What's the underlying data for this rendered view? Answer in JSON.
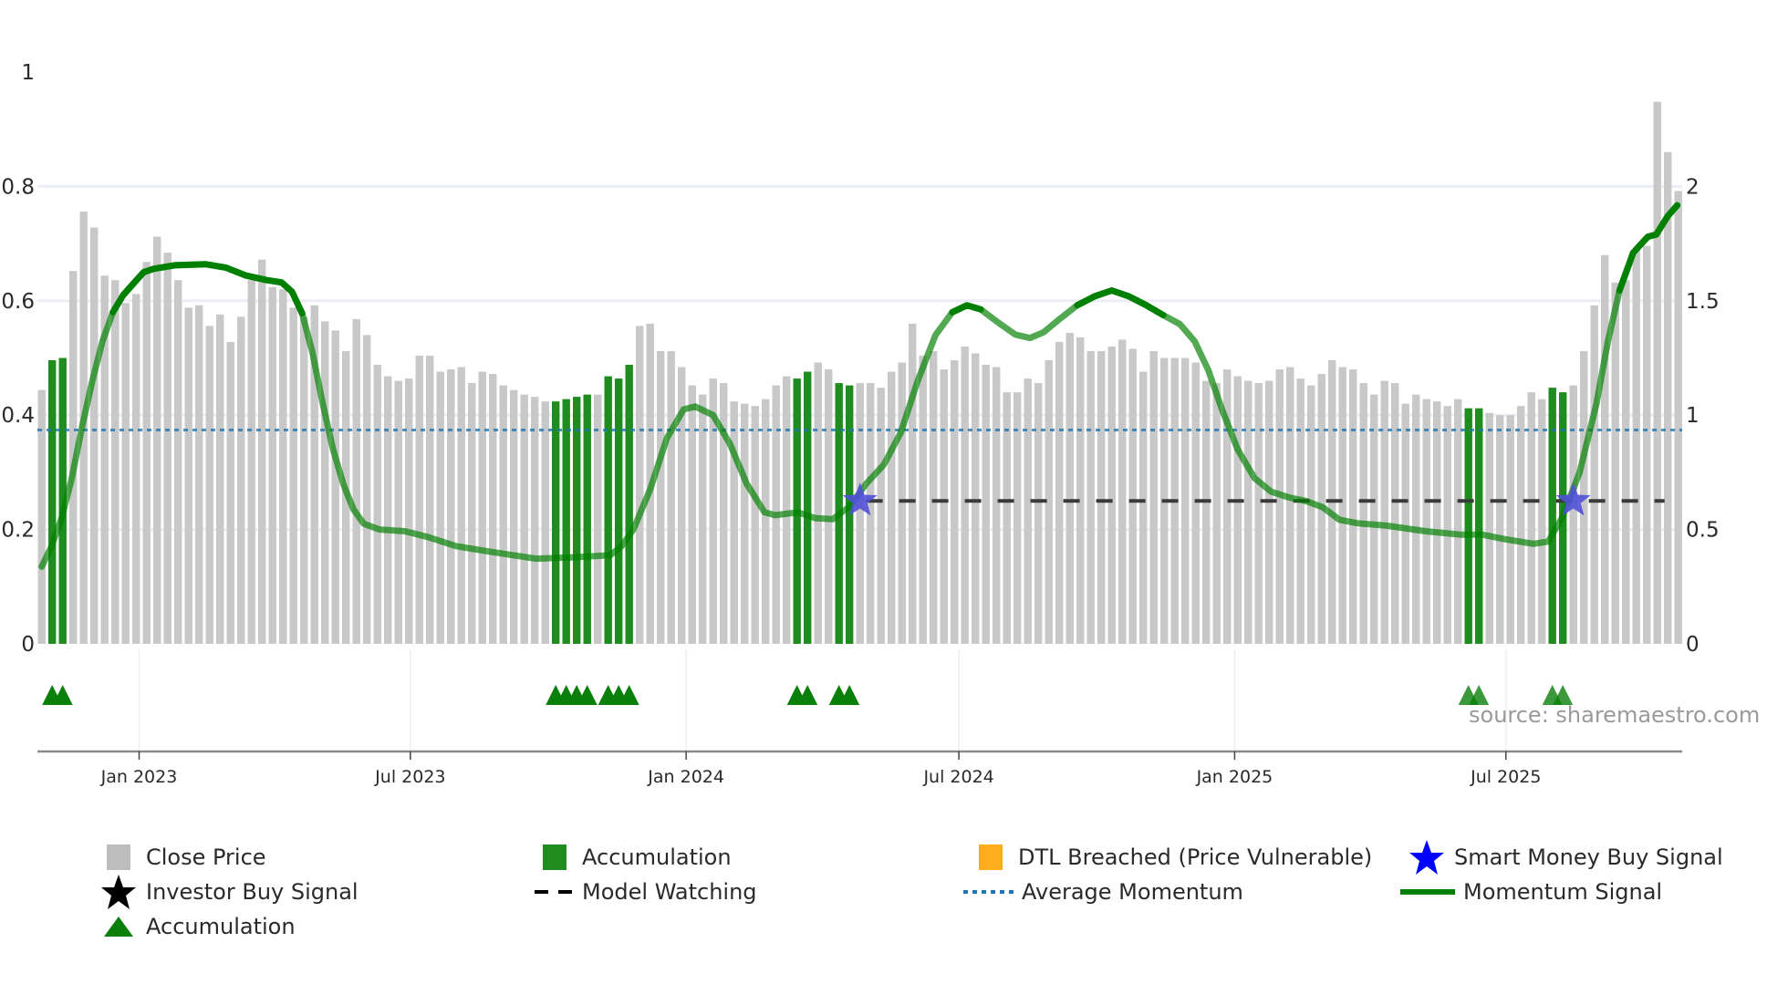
{
  "chart_data": {
    "type": "bar",
    "title": "",
    "start_date": "2022-10-28",
    "interval": "weekly",
    "left_axis": {
      "ylim": [
        0,
        1
      ],
      "ticks": [
        "0",
        "0.2",
        "0.4",
        "0.6",
        "0.8",
        "1"
      ]
    },
    "right_axis": {
      "ylim": [
        0,
        2.5
      ],
      "ticks": [
        "0",
        "0.5",
        "1",
        "1.5",
        "2"
      ]
    },
    "x_ticks": [
      {
        "date": "2023-01-01",
        "label": "Jan 2023"
      },
      {
        "date": "2023-07-01",
        "label": "Jul 2023"
      },
      {
        "date": "2024-01-01",
        "label": "Jan 2024"
      },
      {
        "date": "2024-07-01",
        "label": "Jul 2024"
      },
      {
        "date": "2025-01-01",
        "label": "Jan 2025"
      },
      {
        "date": "2025-07-01",
        "label": "Jul 2025"
      }
    ],
    "close_price": [
      1.11,
      1.24,
      1.25,
      1.63,
      1.89,
      1.82,
      1.61,
      1.59,
      1.49,
      1.53,
      1.67,
      1.78,
      1.71,
      1.59,
      1.47,
      1.48,
      1.39,
      1.44,
      1.32,
      1.43,
      1.59,
      1.68,
      1.56,
      1.55,
      1.47,
      1.43,
      1.48,
      1.41,
      1.37,
      1.28,
      1.42,
      1.35,
      1.22,
      1.17,
      1.15,
      1.16,
      1.26,
      1.26,
      1.19,
      1.2,
      1.21,
      1.14,
      1.19,
      1.18,
      1.13,
      1.11,
      1.09,
      1.08,
      1.06,
      1.06,
      1.07,
      1.08,
      1.09,
      1.09,
      1.17,
      1.16,
      1.22,
      1.39,
      1.4,
      1.28,
      1.28,
      1.21,
      1.13,
      1.09,
      1.16,
      1.14,
      1.06,
      1.05,
      1.04,
      1.07,
      1.13,
      1.17,
      1.16,
      1.19,
      1.23,
      1.2,
      1.14,
      1.13,
      1.14,
      1.14,
      1.12,
      1.19,
      1.23,
      1.4,
      1.26,
      1.28,
      1.2,
      1.24,
      1.3,
      1.27,
      1.22,
      1.21,
      1.1,
      1.1,
      1.16,
      1.14,
      1.24,
      1.32,
      1.36,
      1.34,
      1.28,
      1.28,
      1.3,
      1.33,
      1.29,
      1.19,
      1.28,
      1.25,
      1.25,
      1.25,
      1.23,
      1.15,
      1.14,
      1.2,
      1.17,
      1.15,
      1.14,
      1.15,
      1.2,
      1.21,
      1.16,
      1.13,
      1.18,
      1.24,
      1.21,
      1.2,
      1.14,
      1.09,
      1.15,
      1.14,
      1.05,
      1.09,
      1.07,
      1.06,
      1.04,
      1.07,
      1.03,
      1.03,
      1.01,
      1.0,
      1.0,
      1.04,
      1.1,
      1.07,
      1.12,
      1.1,
      1.13,
      1.28,
      1.48,
      1.7,
      1.58,
      1.59,
      1.72,
      1.74,
      2.37,
      2.15,
      1.98
    ],
    "accumulation_weeks": [
      1,
      2,
      49,
      50,
      51,
      52,
      54,
      55,
      56,
      72,
      73,
      76,
      77,
      136,
      137,
      144,
      145
    ],
    "momentum_signal": [
      [
        0,
        0.135
      ],
      [
        0.92,
        0.17
      ],
      [
        1.9,
        0.22
      ],
      [
        2.87,
        0.29
      ],
      [
        3.85,
        0.38
      ],
      [
        4.83,
        0.46
      ],
      [
        5.81,
        0.53
      ],
      [
        6.79,
        0.58
      ],
      [
        7.77,
        0.61
      ],
      [
        8.74,
        0.63
      ],
      [
        9.72,
        0.65
      ],
      [
        10.7,
        0.656
      ],
      [
        12.66,
        0.662
      ],
      [
        15.6,
        0.664
      ],
      [
        17.55,
        0.658
      ],
      [
        19.5,
        0.644
      ],
      [
        21.46,
        0.636
      ],
      [
        22.87,
        0.632
      ],
      [
        23.85,
        0.616
      ],
      [
        24.83,
        0.578
      ],
      [
        25.8,
        0.51
      ],
      [
        26.79,
        0.42
      ],
      [
        27.77,
        0.34
      ],
      [
        28.74,
        0.28
      ],
      [
        29.72,
        0.235
      ],
      [
        30.7,
        0.21
      ],
      [
        32.2,
        0.2
      ],
      [
        34.6,
        0.197
      ],
      [
        36.8,
        0.187
      ],
      [
        39.5,
        0.171
      ],
      [
        42.8,
        0.161
      ],
      [
        47.1,
        0.149
      ],
      [
        50.4,
        0.151
      ],
      [
        54.2,
        0.155
      ],
      [
        55.3,
        0.171
      ],
      [
        56.4,
        0.2
      ],
      [
        58,
        0.27
      ],
      [
        59.6,
        0.36
      ],
      [
        61.2,
        0.41
      ],
      [
        62.3,
        0.415
      ],
      [
        64,
        0.4
      ],
      [
        65.6,
        0.35
      ],
      [
        67.2,
        0.28
      ],
      [
        68.9,
        0.23
      ],
      [
        69.9,
        0.225
      ],
      [
        72.1,
        0.23
      ],
      [
        73.7,
        0.22
      ],
      [
        75.4,
        0.218
      ],
      [
        77,
        0.24
      ],
      [
        78.6,
        0.28
      ],
      [
        80.3,
        0.314
      ],
      [
        81.9,
        0.37
      ],
      [
        83.5,
        0.46
      ],
      [
        85.2,
        0.54
      ],
      [
        86.8,
        0.58
      ],
      [
        88.2,
        0.592
      ],
      [
        89.5,
        0.585
      ],
      [
        91.1,
        0.563
      ],
      [
        92.8,
        0.541
      ],
      [
        94.2,
        0.535
      ],
      [
        95.5,
        0.545
      ],
      [
        97.1,
        0.569
      ],
      [
        98.7,
        0.592
      ],
      [
        100.4,
        0.608
      ],
      [
        102,
        0.618
      ],
      [
        103.6,
        0.608
      ],
      [
        105.3,
        0.592
      ],
      [
        106.9,
        0.575
      ],
      [
        108.5,
        0.559
      ],
      [
        109.9,
        0.529
      ],
      [
        111.2,
        0.479
      ],
      [
        112.5,
        0.41
      ],
      [
        114,
        0.34
      ],
      [
        115.6,
        0.29
      ],
      [
        117.2,
        0.266
      ],
      [
        118.9,
        0.256
      ],
      [
        120.5,
        0.25
      ],
      [
        122.1,
        0.239
      ],
      [
        123.7,
        0.217
      ],
      [
        125.4,
        0.211
      ],
      [
        128.1,
        0.207
      ],
      [
        131.9,
        0.197
      ],
      [
        135.2,
        0.191
      ],
      [
        137.3,
        0.191
      ],
      [
        139.5,
        0.183
      ],
      [
        142.2,
        0.175
      ],
      [
        143.6,
        0.179
      ],
      [
        144.9,
        0.22
      ],
      [
        146.6,
        0.3
      ],
      [
        148.2,
        0.42
      ],
      [
        149.3,
        0.53
      ],
      [
        150.4,
        0.618
      ],
      [
        151.7,
        0.684
      ],
      [
        153.1,
        0.712
      ],
      [
        153.9,
        0.716
      ],
      [
        155,
        0.748
      ],
      [
        155.9,
        0.767
      ]
    ],
    "average_momentum": 0.374,
    "model_watching": {
      "value": 0.25,
      "from_week": 78.6,
      "to_week": 154.7
    },
    "smart_money_buy_signals": [
      {
        "week": 78,
        "value": 0.25
      },
      {
        "week": 146,
        "value": 0.25
      }
    ],
    "legend_placement": "bottom",
    "colors": {
      "close": "#c8c8c8",
      "accumulation": "#1e8c1e",
      "dtl": "#ffad1f",
      "smart_money": "#0000ff",
      "smart_money_plot": "#5050d8",
      "investor": "#000000",
      "model": "#3a3a3a",
      "avg": "#1f77b4",
      "momentum": "#008000",
      "triangle": "#0a800a"
    }
  },
  "legend": {
    "close_price": "Close Price",
    "accumulation_bar": "Accumulation",
    "dtl_breached": "DTL Breached (Price Vulnerable)",
    "smart_money": "Smart Money Buy Signal",
    "investor_buy": "Investor Buy Signal",
    "model_watching": "Model Watching",
    "average_momentum": "Average Momentum",
    "momentum_signal": "Momentum Signal",
    "accumulation_marker": "Accumulation"
  },
  "watermark": "source: sharemaestro.com"
}
